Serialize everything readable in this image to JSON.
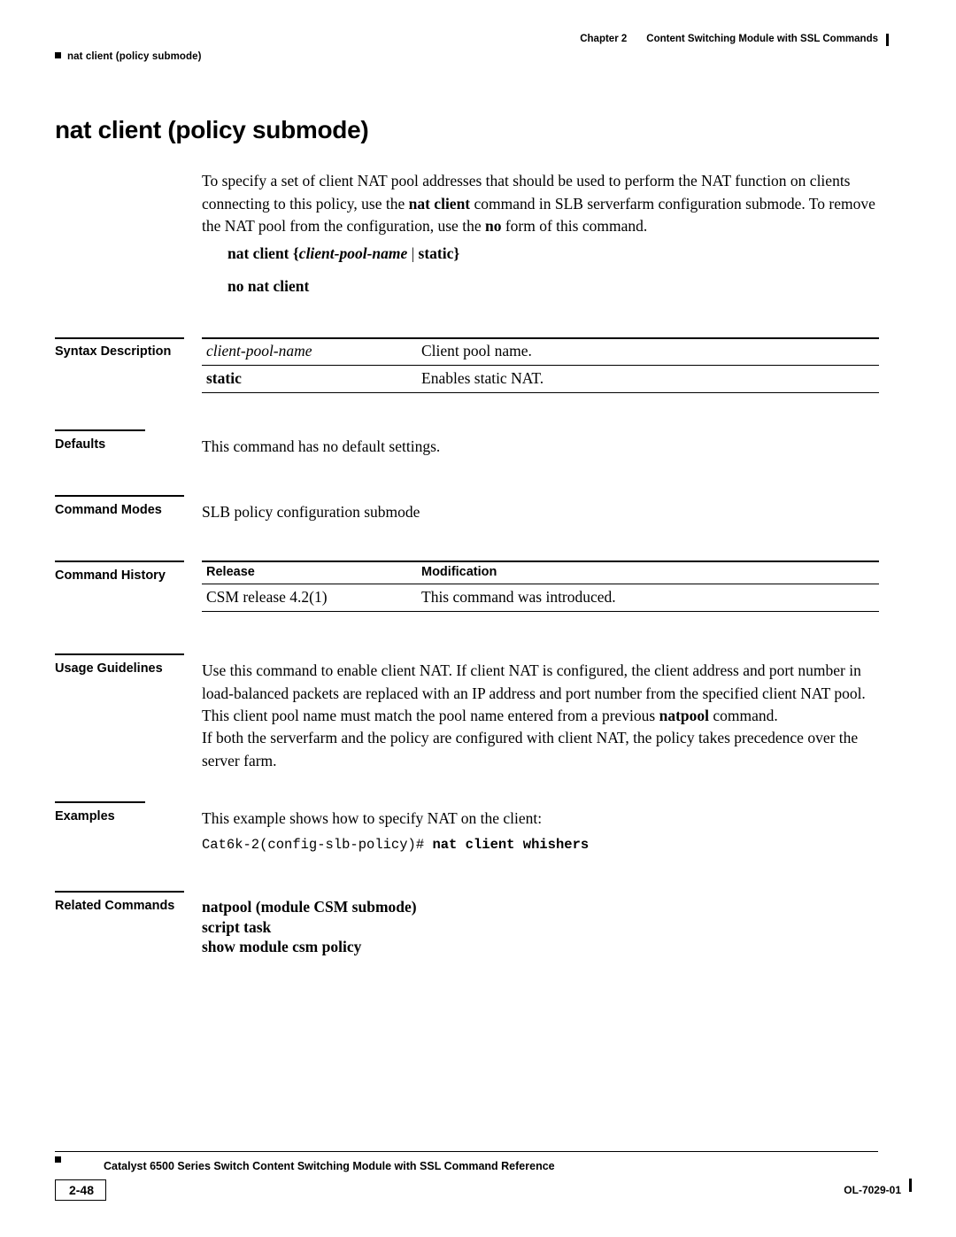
{
  "header": {
    "left_text": "nat client (policy submode)",
    "chapter_label": "Chapter 2",
    "chapter_title": "Content Switching Module with SSL Commands"
  },
  "title": "nat client (policy submode)",
  "intro": {
    "part1": "To specify a set of client NAT pool addresses that should be used to perform the NAT function on clients connecting to this policy, use the ",
    "bold1": "nat client",
    "part2": " command in SLB serverfarm configuration submode. To remove the NAT pool from the configuration, use the ",
    "bold2": "no",
    "part3": " form of this command."
  },
  "syntax": {
    "command": "nat client",
    "arg_italic": "client-pool-name",
    "pipe": " | ",
    "keyword": "static",
    "open_brace": "{",
    "close_brace": "}",
    "no_form": "no nat client"
  },
  "sections": {
    "syntax_description": {
      "label": "Syntax Description",
      "rows": [
        {
          "term": "client-pool-name",
          "style": "italic",
          "desc": "Client pool name."
        },
        {
          "term": "static",
          "style": "bold",
          "desc": "Enables static NAT."
        }
      ]
    },
    "defaults": {
      "label": "Defaults",
      "text": "This command has no default settings."
    },
    "command_modes": {
      "label": "Command Modes",
      "text": "SLB policy configuration submode"
    },
    "command_history": {
      "label": "Command History",
      "headers": [
        "Release",
        "Modification"
      ],
      "rows": [
        {
          "release": "CSM release 4.2(1)",
          "modification": "This command was introduced."
        }
      ]
    },
    "usage_guidelines": {
      "label": "Usage Guidelines",
      "para1_a": "Use this command to enable client NAT. If client NAT is configured, the client address and port number in load-balanced packets are replaced with an IP address and port number from the specified client NAT pool. This client pool name must match the pool name entered from a previous ",
      "para1_bold": "natpool",
      "para1_b": " command.",
      "para2": "If both the serverfarm and the policy are configured with client NAT, the policy takes precedence over the server farm."
    },
    "examples": {
      "label": "Examples",
      "text": "This example shows how to specify NAT on the client:",
      "code_prompt": "Cat6k-2(config-slb-policy)# ",
      "code_command": "nat client whishers"
    },
    "related_commands": {
      "label": "Related Commands",
      "items": [
        "natpool (module CSM submode)",
        "script task",
        "show module csm policy"
      ]
    }
  },
  "footer": {
    "title": "Catalyst 6500 Series Switch Content Switching Module with SSL Command Reference",
    "page_number": "2-48",
    "doc_id": "OL-7029-01"
  }
}
